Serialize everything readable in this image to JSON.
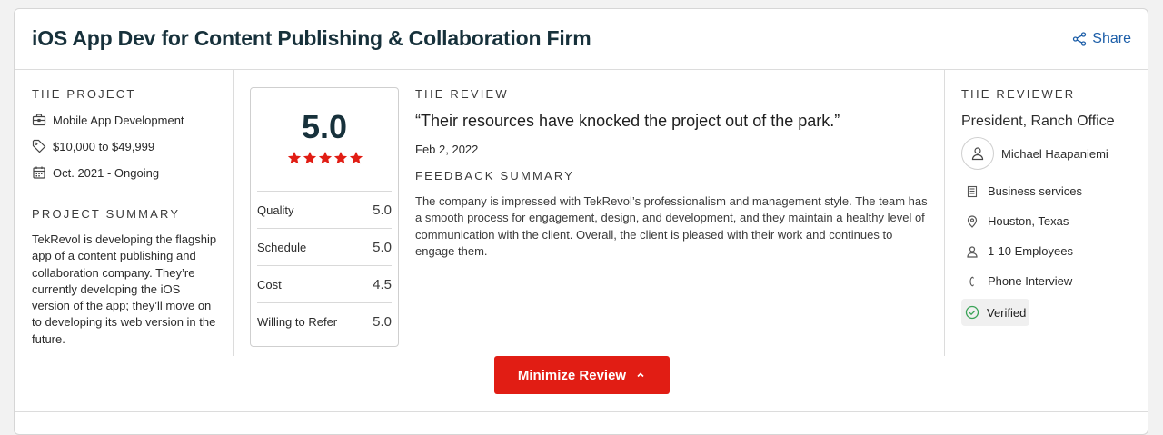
{
  "review": {
    "title": "iOS App Dev for Content Publishing & Collaboration Firm",
    "share_label": "Share"
  },
  "project": {
    "heading": "THE PROJECT",
    "service": "Mobile App Development",
    "budget": "$10,000 to $49,999",
    "timeline": "Oct. 2021 - Ongoing",
    "summary_heading": "PROJECT SUMMARY",
    "summary": "TekRevol is developing the flagship app of a content publishing and collaboration company. They’re currently developing the iOS version of the app; they’ll move on to developing its web version in the future."
  },
  "rating": {
    "overall": "5.0",
    "stars": 5,
    "rows": [
      {
        "label": "Quality",
        "value": "5.0"
      },
      {
        "label": "Schedule",
        "value": "5.0"
      },
      {
        "label": "Cost",
        "value": "4.5"
      },
      {
        "label": "Willing to Refer",
        "value": "5.0"
      }
    ]
  },
  "the_review": {
    "heading": "THE REVIEW",
    "quote": "“Their resources have knocked the project out of the park.”",
    "date": "Feb 2, 2022",
    "feedback_heading": "FEEDBACK SUMMARY",
    "feedback": "The company is impressed with TekRevol’s professionalism and management style. The team has a smooth process for engagement, design, and development, and they maintain a healthy level of communication with the client. Overall, the client is pleased with their work and continues to engage them."
  },
  "reviewer": {
    "heading": "THE REVIEWER",
    "title": "President, Ranch Office",
    "name": "Michael Haapaniemi",
    "industry": "Business services",
    "location": "Houston, Texas",
    "size": "1-10 Employees",
    "method": "Phone Interview",
    "verified": "Verified"
  },
  "actions": {
    "minimize_label": "Minimize Review"
  },
  "colors": {
    "accent_red": "#e11d14",
    "link_blue": "#1c5ea8",
    "verified_green": "#3aa357"
  }
}
